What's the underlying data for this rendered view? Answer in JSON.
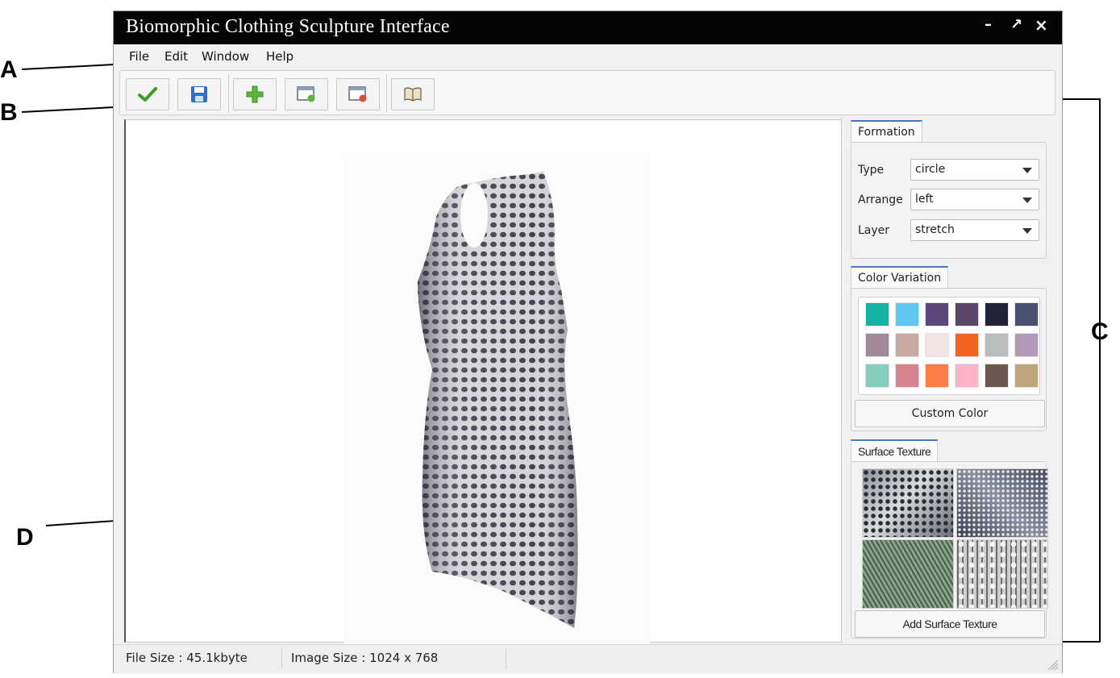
{
  "callouts": {
    "a": "A",
    "b": "B",
    "c": "C",
    "d": "D"
  },
  "window": {
    "title": "Biomorphic Clothing Sculpture Interface",
    "controls": {
      "minimize": "–",
      "maximize": "↗",
      "close": "×"
    }
  },
  "menu": {
    "items": [
      "File",
      "Edit",
      "Window",
      "Help"
    ]
  },
  "toolbar": {
    "buttons": [
      "confirm-icon",
      "save-icon",
      "add-icon",
      "new-window-icon",
      "close-window-icon",
      "book-icon"
    ]
  },
  "formation": {
    "tab": "Formation",
    "type_label": "Type",
    "type_value": "circle",
    "arrange_label": "Arrange",
    "arrange_value": "left",
    "layer_label": "Layer",
    "layer_value": "stretch"
  },
  "color_variation": {
    "tab": "Color Variation",
    "swatches": [
      "#14b3a4",
      "#5ec8f2",
      "#5a467a",
      "#5a4668",
      "#22223a",
      "#4a5070",
      "#9e8a98",
      "#caa9a2",
      "#f1e4e2",
      "#f2641e",
      "#b7bdbd",
      "#b399b8",
      "#85cdc0",
      "#d5838c",
      "#fc7d48",
      "#fab4c8",
      "#6b584f",
      "#bfa57d"
    ],
    "custom_button": "Custom Color"
  },
  "surface_texture": {
    "tab": "Surface Texture",
    "add_button": "Add Surface Texture"
  },
  "status": {
    "file_size": "File Size : 45.1kbyte",
    "image_size": "Image Size : 1024 x 768"
  },
  "colors": {
    "titlebar": "#050505",
    "tab_accent": "#4a78c4",
    "check_green": "#3f9a2a"
  }
}
